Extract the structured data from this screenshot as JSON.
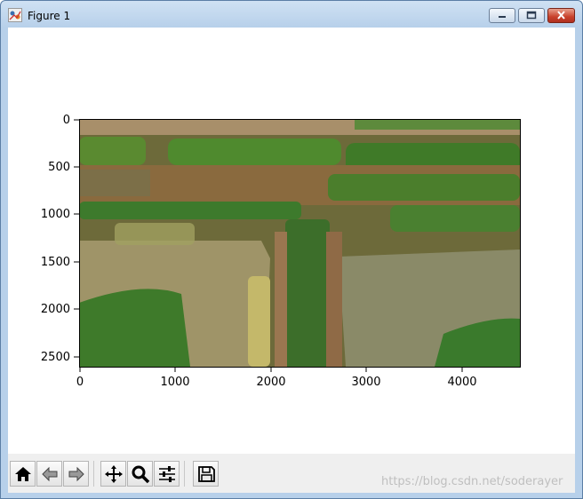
{
  "window": {
    "title": "Figure 1"
  },
  "plot": {
    "x_ticks": [
      "0",
      "1000",
      "2000",
      "3000",
      "4000"
    ],
    "y_ticks": [
      "0",
      "500",
      "1000",
      "1500",
      "2000",
      "2500"
    ],
    "xlim": [
      0,
      4600
    ],
    "ylim": [
      2600,
      0
    ]
  },
  "toolbar": {
    "icons": [
      "home-icon",
      "back-icon",
      "forward-icon",
      "pan-icon",
      "zoom-icon",
      "configure-subplots-icon",
      "save-icon"
    ]
  },
  "watermark": "https://blog.csdn.net/soderayer"
}
